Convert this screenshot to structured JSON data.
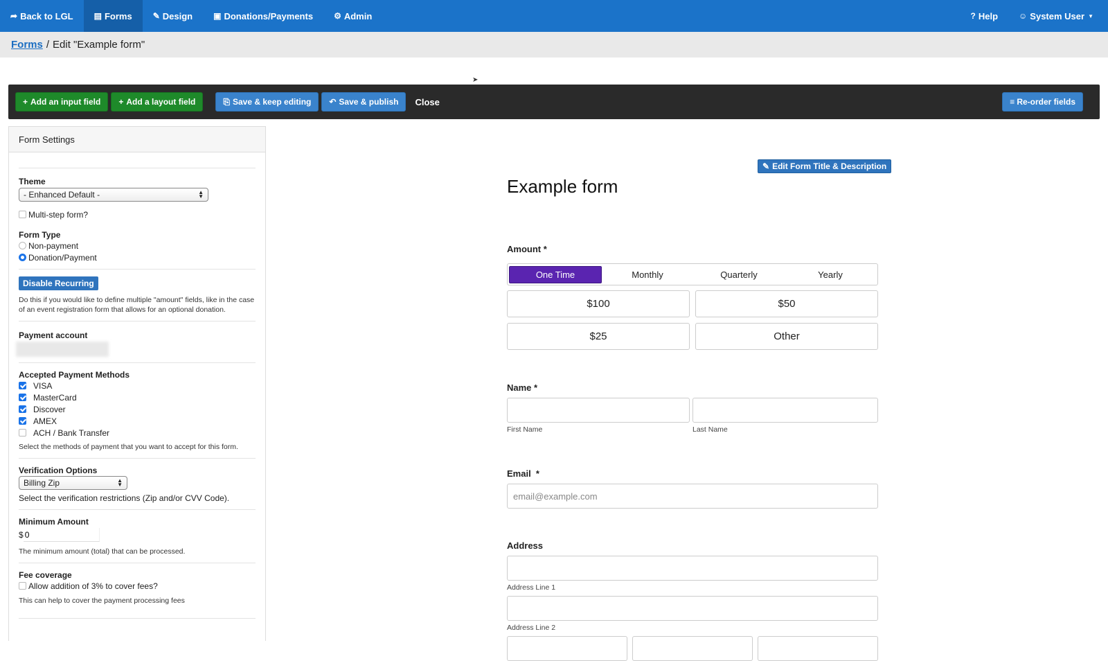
{
  "nav": {
    "items": [
      {
        "icon": "share-icon",
        "glyph": "➦",
        "label": "Back to LGL"
      },
      {
        "icon": "form-icon",
        "glyph": "▤",
        "label": "Forms"
      },
      {
        "icon": "pencil-icon",
        "glyph": "✎",
        "label": "Design"
      },
      {
        "icon": "money-icon",
        "glyph": "▣",
        "label": "Donations/Payments"
      },
      {
        "icon": "gear-icon",
        "glyph": "⚙",
        "label": "Admin"
      }
    ],
    "help_label": "Help",
    "help_glyph": "?",
    "user_label": "System User",
    "user_glyph": "☺",
    "active": "Forms"
  },
  "breadcrumb": {
    "link": "Forms",
    "separator": "/",
    "current": "Edit \"Example form\""
  },
  "toolbar": {
    "add_input": "Add an input field",
    "add_layout": "Add a layout field",
    "save_keep": "Save & keep editing",
    "save_publish": "Save & publish",
    "close": "Close",
    "reorder": "Re-order fields",
    "plus_glyph": "+",
    "save_glyph": "⎘",
    "publish_glyph": "↶",
    "list_glyph": "≡"
  },
  "settings": {
    "header": "Form Settings",
    "theme_label": "Theme",
    "theme_value": "- Enhanced Default -",
    "multistep_label": "Multi-step form?",
    "multistep_checked": false,
    "form_type_label": "Form Type",
    "form_type_options": [
      "Non-payment",
      "Donation/Payment"
    ],
    "form_type_selected": "Donation/Payment",
    "disable_recurring": "Disable Recurring",
    "recurring_help": "Do this if you would like to define multiple \"amount\" fields, like in the case of an event registration form that allows for an optional donation.",
    "payment_account_label": "Payment account",
    "methods_label": "Accepted Payment Methods",
    "methods": [
      {
        "label": "VISA",
        "checked": true
      },
      {
        "label": "MasterCard",
        "checked": true
      },
      {
        "label": "Discover",
        "checked": true
      },
      {
        "label": "AMEX",
        "checked": true
      },
      {
        "label": "ACH / Bank Transfer",
        "checked": false
      }
    ],
    "methods_help": "Select the methods of payment that you want to accept for this form.",
    "verification_label": "Verification Options",
    "verification_value": "Billing Zip",
    "verification_help": "Select the verification restrictions (Zip and/or CVV Code).",
    "min_amount_label": "Minimum Amount",
    "currency": "$",
    "min_amount_value": "0",
    "min_amount_help": "The minimum amount (total) that can be processed.",
    "fee_label": "Fee coverage",
    "fee_checkbox": "Allow addition of 3% to cover fees?",
    "fee_checked": false,
    "fee_help": "This can help to cover the payment processing fees"
  },
  "preview": {
    "edit_title_btn": "Edit Form Title & Description",
    "edit_glyph": "✎",
    "title": "Example form",
    "amount_label": "Amount *",
    "frequencies": [
      "One Time",
      "Monthly",
      "Quarterly",
      "Yearly"
    ],
    "frequency_selected": "One Time",
    "amounts": [
      "$100",
      "$50",
      "$25",
      "Other"
    ],
    "name_label": "Name *",
    "first_name": "First Name",
    "last_name": "Last Name",
    "email_label": "Email  *",
    "email_placeholder": "email@example.com",
    "address_label": "Address",
    "address_line1": "Address Line 1",
    "address_line2": "Address Line 2"
  }
}
